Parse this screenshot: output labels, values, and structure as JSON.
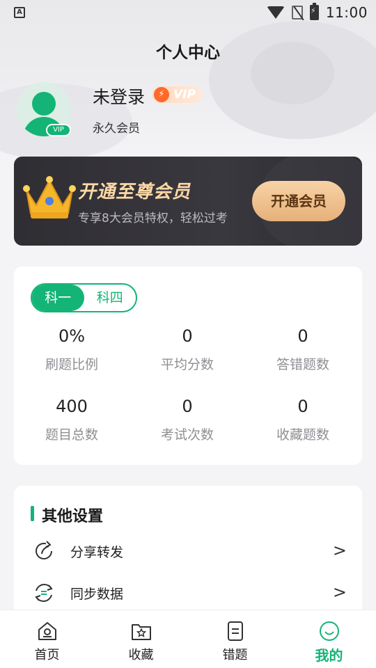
{
  "status_bar": {
    "left_glyph": "A",
    "time": "11:00"
  },
  "header": {
    "title": "个人中心"
  },
  "profile": {
    "name": "未登录",
    "vip_tag": "VIP",
    "avatar_badge": "VIP",
    "member_status": "永久会员"
  },
  "vip_banner": {
    "title": "开通至尊会员",
    "subtitle": "专享8大会员特权，轻松过考",
    "button_label": "开通会员"
  },
  "stats": {
    "tabs": [
      {
        "label": "科一",
        "active": true
      },
      {
        "label": "科四",
        "active": false
      }
    ],
    "items": [
      {
        "value": "0%",
        "label": "刷题比例"
      },
      {
        "value": "0",
        "label": "平均分数"
      },
      {
        "value": "0",
        "label": "答错题数"
      },
      {
        "value": "400",
        "label": "题目总数"
      },
      {
        "value": "0",
        "label": "考试次数"
      },
      {
        "value": "0",
        "label": "收藏题数"
      }
    ]
  },
  "settings": {
    "title": "其他设置",
    "rows": [
      {
        "label": "分享转发",
        "icon": "share-icon",
        "chevron": ">"
      },
      {
        "label": "同步数据",
        "icon": "sync-icon",
        "chevron": ">"
      }
    ]
  },
  "bottom_nav": {
    "items": [
      {
        "label": "首页",
        "icon": "home-icon",
        "active": false
      },
      {
        "label": "收藏",
        "icon": "favorites-folder-icon",
        "active": false
      },
      {
        "label": "错题",
        "icon": "document-icon",
        "active": false
      },
      {
        "label": "我的",
        "icon": "smile-profile-icon",
        "active": true
      }
    ]
  },
  "colors": {
    "accent": "#13b475",
    "banner_bg": "#2f2e33",
    "banner_title": "#ffd9a6",
    "banner_button": "#f0c28c"
  }
}
